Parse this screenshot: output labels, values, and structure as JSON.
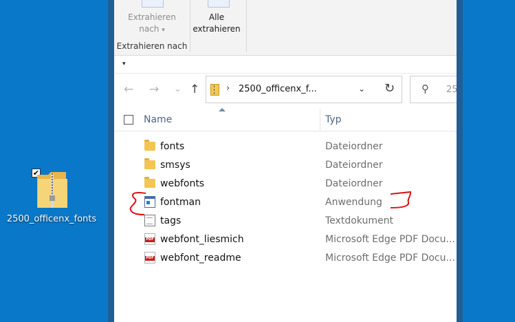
{
  "desktop": {
    "icon_label": "2500_officenx_fonts",
    "checkbox_mark": "✔"
  },
  "ribbon": {
    "extract_to_label_line1": "Extrahieren",
    "extract_to_label_line2": "nach",
    "extract_to_dropdown": "▾",
    "extract_all_line1": "Alle",
    "extract_all_line2": "extrahieren",
    "group_label": "Extrahieren nach"
  },
  "qat": {
    "customize_arrow": "▾"
  },
  "nav": {
    "back": "←",
    "forward": "→",
    "recent": "⌄",
    "up": "↑",
    "address_chevron": "›",
    "address_text": "2500_officenx_f...",
    "address_dropdown": "⌄",
    "refresh": "↻",
    "search_icon": "⚲",
    "search_text": "25"
  },
  "columns": {
    "name": "Name",
    "type": "Typ"
  },
  "files": [
    {
      "name": "fonts",
      "type": "Dateiordner",
      "icon": "folder-icon"
    },
    {
      "name": "smsys",
      "type": "Dateiordner",
      "icon": "folder-icon"
    },
    {
      "name": "webfonts",
      "type": "Dateiordner",
      "icon": "folder-icon"
    },
    {
      "name": "fontman",
      "type": "Anwendung",
      "icon": "application-icon"
    },
    {
      "name": "tags",
      "type": "Textdokument",
      "icon": "text-document-icon"
    },
    {
      "name": "webfont_liesmich",
      "type": "Microsoft Edge PDF Docu...",
      "icon": "pdf-icon"
    },
    {
      "name": "webfont_readme",
      "type": "Microsoft Edge PDF Docu...",
      "icon": "pdf-icon"
    }
  ],
  "colors": {
    "desktop": "#0a78c8",
    "annotation": "#e01010",
    "header_text": "#4d6480"
  }
}
